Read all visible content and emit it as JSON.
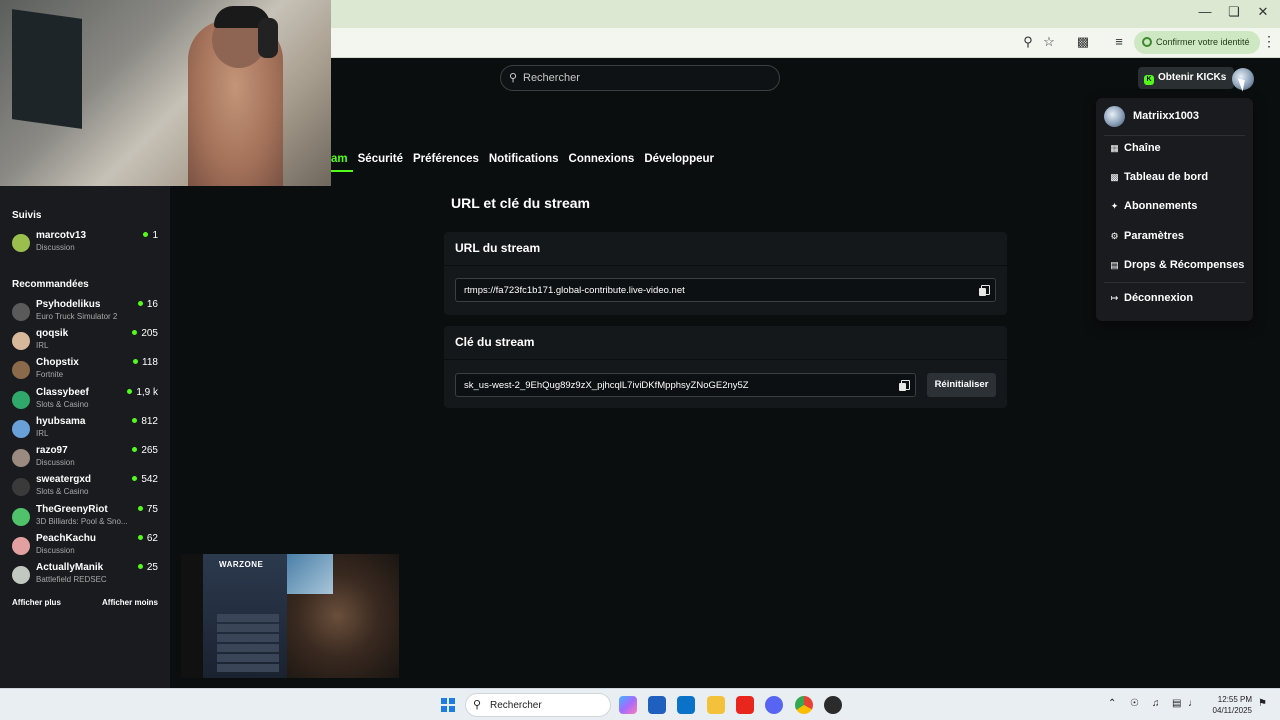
{
  "browser": {
    "verify_label": "Confirmer votre identité"
  },
  "header": {
    "search_placeholder": "Rechercher",
    "kicks_label": "Obtenir KICKs"
  },
  "tabs": [
    {
      "label": "am",
      "active": true
    },
    {
      "label": "Sécurité"
    },
    {
      "label": "Préférences"
    },
    {
      "label": "Notifications"
    },
    {
      "label": "Connexions"
    },
    {
      "label": "Développeur"
    }
  ],
  "content": {
    "title": "URL et clé du stream",
    "url_card": {
      "heading": "URL du stream",
      "value": "rtmps://fa723fc1b171.global-contribute.live-video.net"
    },
    "key_card": {
      "heading": "Clé du stream",
      "value": "sk_us-west-2_9EhQug89z9zX_pjhcqlL7iviDKfMpphsyZNoGE2ny5Z",
      "reset_label": "Réinitialiser"
    }
  },
  "sidebar": {
    "followed_title": "Suivis",
    "followed": [
      {
        "name": "marcotv13",
        "category": "Discussion",
        "viewers": "1",
        "avatar_color": "#9bbf4e"
      }
    ],
    "recommended_title": "Recommandées",
    "recommended": [
      {
        "name": "Psyhodelikus",
        "category": "Euro Truck Simulator 2",
        "viewers": "16",
        "avatar_color": "#5a5a5a"
      },
      {
        "name": "qoqsik",
        "category": "IRL",
        "viewers": "205",
        "avatar_color": "#d8b89a"
      },
      {
        "name": "Chopstix",
        "category": "Fortnite",
        "viewers": "118",
        "avatar_color": "#8a6a4a"
      },
      {
        "name": "Classybeef",
        "category": "Slots & Casino",
        "viewers": "1,9 k",
        "avatar_color": "#2fa86a"
      },
      {
        "name": "hyubsama",
        "category": "IRL",
        "viewers": "812",
        "avatar_color": "#6aa0d8"
      },
      {
        "name": "razo97",
        "category": "Discussion",
        "viewers": "265",
        "avatar_color": "#9a8a80"
      },
      {
        "name": "sweatergxd",
        "category": "Slots & Casino",
        "viewers": "542",
        "avatar_color": "#3a3a3a"
      },
      {
        "name": "TheGreenyRiot",
        "category": "3D Billiards: Pool & Sno...",
        "viewers": "75",
        "avatar_color": "#4fc26a"
      },
      {
        "name": "PeachKachu",
        "category": "Discussion",
        "viewers": "62",
        "avatar_color": "#e2a0a0"
      },
      {
        "name": "ActuallyManik",
        "category": "Battlefield REDSEC",
        "viewers": "25",
        "avatar_color": "#c0c8c0"
      }
    ],
    "show_more": "Afficher plus",
    "show_less": "Afficher moins"
  },
  "game_overlay": {
    "logo": "WARZONE"
  },
  "dropdown": {
    "username": "Matriixx1003",
    "items": [
      {
        "label": "Chaîne",
        "icon": "channel-icon"
      },
      {
        "label": "Tableau de bord",
        "icon": "dashboard-icon"
      },
      {
        "label": "Abonnements",
        "icon": "sparkle-icon"
      },
      {
        "label": "Paramètres",
        "icon": "gear-icon"
      },
      {
        "label": "Drops & Récompenses",
        "icon": "gift-icon"
      },
      {
        "label": "Déconnexion",
        "icon": "logout-icon"
      }
    ]
  },
  "taskbar": {
    "search_label": "Rechercher",
    "time": "12:55 PM",
    "date": "04/11/2025"
  },
  "colors": {
    "accent": "#53fc18",
    "background": "#0b0e0f",
    "sidebar": "#191b1f"
  }
}
